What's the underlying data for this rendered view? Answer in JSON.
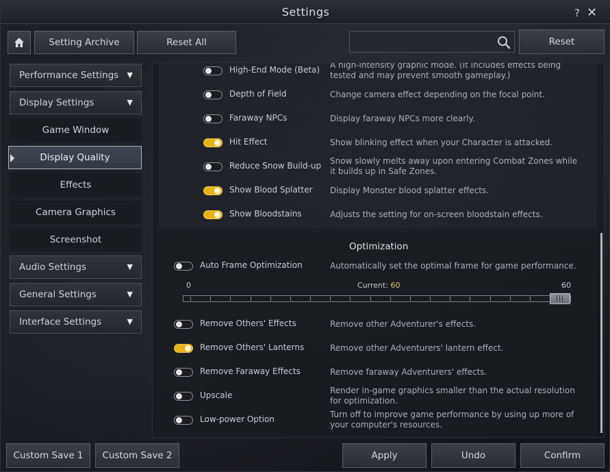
{
  "window": {
    "title": "Settings",
    "help_label": "?",
    "close_label": "✕"
  },
  "toolbar": {
    "archive_label": "Setting Archive",
    "reset_all_label": "Reset All",
    "search_value": "",
    "search_placeholder": "",
    "reset_label": "Reset"
  },
  "sidebar": {
    "items": [
      {
        "label": "Performance Settings",
        "kind": "header"
      },
      {
        "label": "Display Settings",
        "kind": "header"
      },
      {
        "label": "Game Window",
        "kind": "sub"
      },
      {
        "label": "Display Quality",
        "kind": "sub",
        "active": true
      },
      {
        "label": "Effects",
        "kind": "sub"
      },
      {
        "label": "Camera Graphics",
        "kind": "sub"
      },
      {
        "label": "Screenshot",
        "kind": "sub"
      },
      {
        "label": "Audio Settings",
        "kind": "header"
      },
      {
        "label": "General Settings",
        "kind": "header"
      },
      {
        "label": "Interface Settings",
        "kind": "header"
      }
    ]
  },
  "graphics_options": [
    {
      "label": "High-End Mode (Beta)",
      "on": false,
      "description": "A high-intensity graphic mode. (It includes effects being tested and may prevent smooth gameplay.)"
    },
    {
      "label": "Depth of Field",
      "on": false,
      "description": "Change camera effect depending on the focal point."
    },
    {
      "label": "Faraway NPCs",
      "on": false,
      "description": "Display faraway NPCs more clearly."
    },
    {
      "label": "Hit Effect",
      "on": true,
      "description": "Show blinking effect when your Character is attacked."
    },
    {
      "label": "Reduce Snow Build-up",
      "on": false,
      "description": "Snow slowly melts away upon entering Combat Zones while it builds up in Safe Zones."
    },
    {
      "label": "Show Blood Splatter",
      "on": true,
      "description": "Display Monster blood splatter effects."
    },
    {
      "label": "Show Bloodstains",
      "on": true,
      "description": "Adjusts the setting for on-screen bloodstain effects."
    }
  ],
  "optimization": {
    "title": "Optimization",
    "auto_frame": {
      "label": "Auto Frame Optimization",
      "on": false,
      "description": "Automatically set the optimal frame for game performance."
    },
    "slider": {
      "min": "0",
      "max": "60",
      "current_label": "Current:",
      "current_value": "60",
      "thumb_label": "|||",
      "value": 60,
      "min_value": 0,
      "max_value": 60
    },
    "options": [
      {
        "label": "Remove Others' Effects",
        "on": false,
        "description": "Remove other Adventurer's effects."
      },
      {
        "label": "Remove Others' Lanterns",
        "on": true,
        "description": "Remove other Adventurers' lantern effect."
      },
      {
        "label": "Remove Faraway Effects",
        "on": false,
        "description": "Remove faraway Adventurers' effects."
      },
      {
        "label": "Upscale",
        "on": false,
        "description": "Render in-game graphics smaller than the actual resolution for optimization."
      },
      {
        "label": "Low-power Option",
        "on": false,
        "description": "Turn off to improve game performance by using up more of your computer's resources."
      }
    ]
  },
  "footer": {
    "custom_save_1": "Custom Save 1",
    "custom_save_2": "Custom Save 2",
    "apply": "Apply",
    "undo": "Undo",
    "confirm": "Confirm"
  },
  "colors": {
    "toggle_on": "#e8b21b",
    "current_value": "#e6c35a",
    "active_border": "#a9b4c0"
  },
  "icons": {
    "home": "home-icon",
    "search": "search-icon",
    "chevron": "chevron-down-icon"
  }
}
